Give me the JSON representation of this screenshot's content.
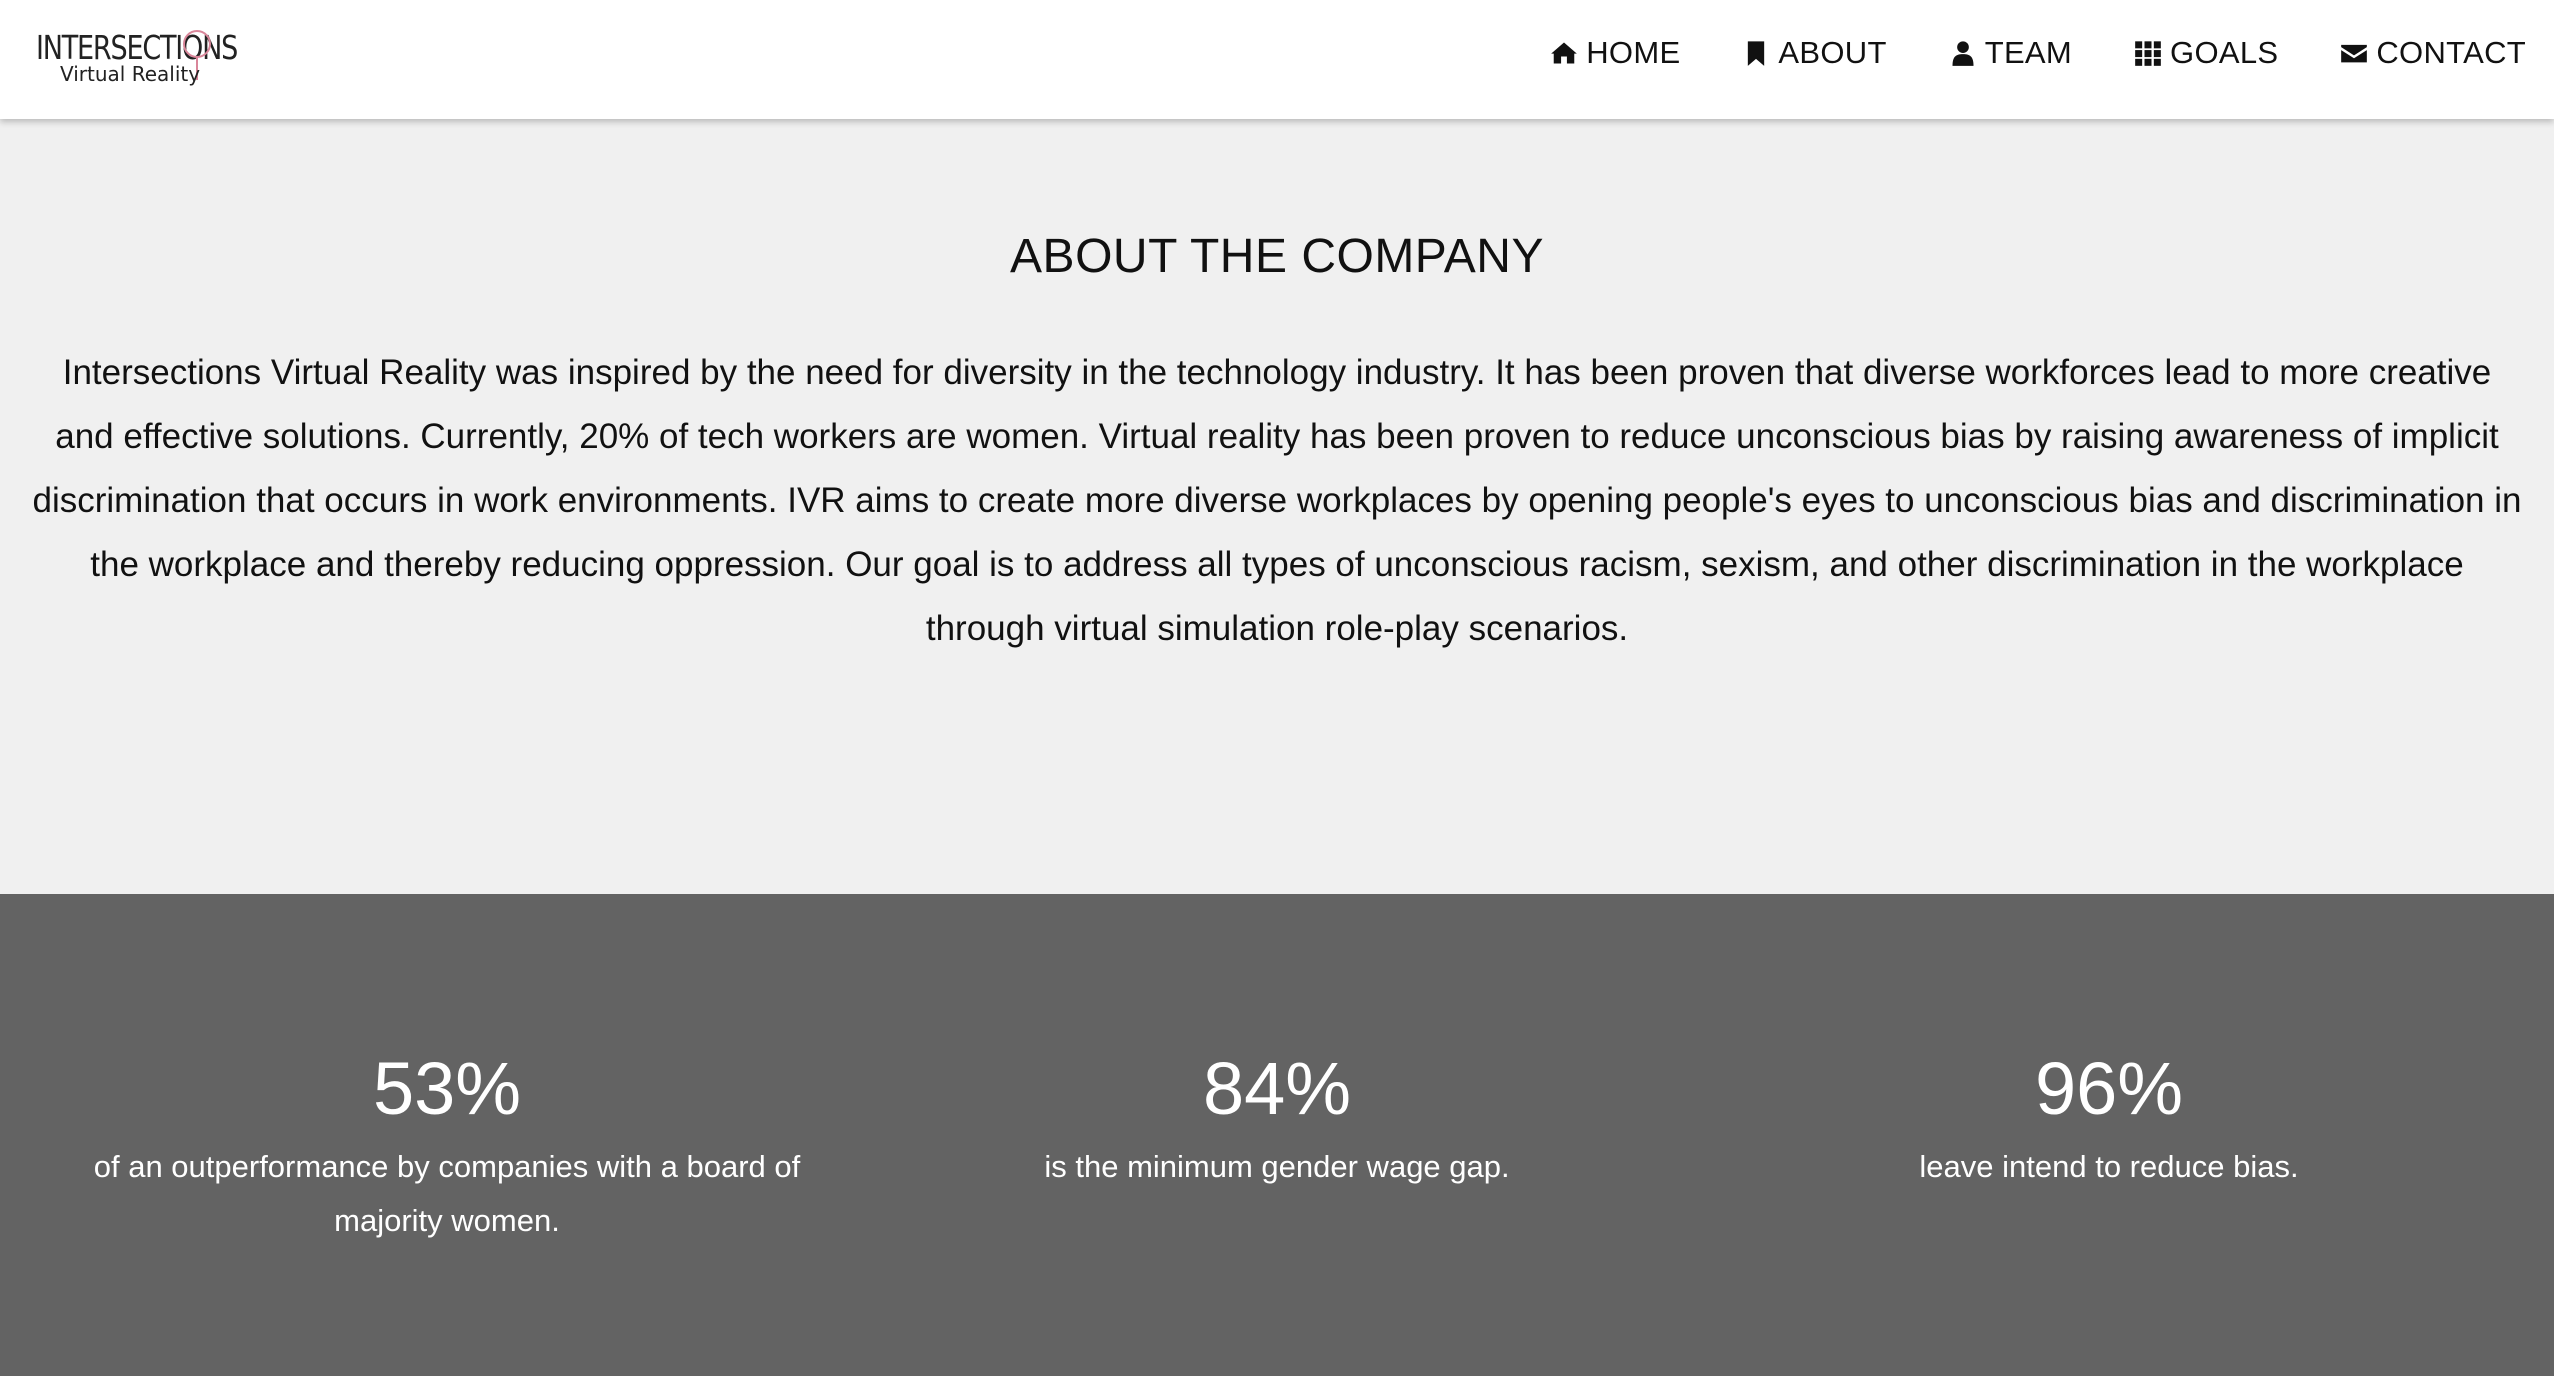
{
  "logo": {
    "line1": "INTERSECTIONS",
    "line2": "Virtual Reality",
    "accent": "#d9869a"
  },
  "nav": [
    {
      "icon": "home-icon",
      "label": "HOME"
    },
    {
      "icon": "bookmark-icon",
      "label": "ABOUT"
    },
    {
      "icon": "user-icon",
      "label": "TEAM"
    },
    {
      "icon": "grid-icon",
      "label": "GOALS"
    },
    {
      "icon": "envelope-icon",
      "label": "CONTACT"
    }
  ],
  "about": {
    "title": "ABOUT THE COMPANY",
    "body": "Intersections Virtual Reality was inspired by the need for diversity in the technology industry. It has been proven that diverse workforces lead to more creative and effective solutions. Currently, 20% of tech workers are women. Virtual reality has been proven to reduce unconscious bias by raising awareness of implicit discrimination that occurs in work environments. IVR aims to create more diverse workplaces by opening people's eyes to unconscious bias and discrimination in the workplace and thereby reducing oppression. Our goal is to address all types of unconscious racism, sexism, and other discrimination in the workplace through virtual simulation role-play scenarios."
  },
  "stats": [
    {
      "value": "53%",
      "description": "of an outperformance by companies with a board of majority women."
    },
    {
      "value": "84%",
      "description": "is the minimum gender wage gap."
    },
    {
      "value": "96%",
      "description": "leave intend to reduce bias."
    }
  ],
  "colors": {
    "navbar_bg": "#ffffff",
    "about_bg": "#f0f0f0",
    "stats_bg": "#636363",
    "stats_text": "#ffffff"
  }
}
